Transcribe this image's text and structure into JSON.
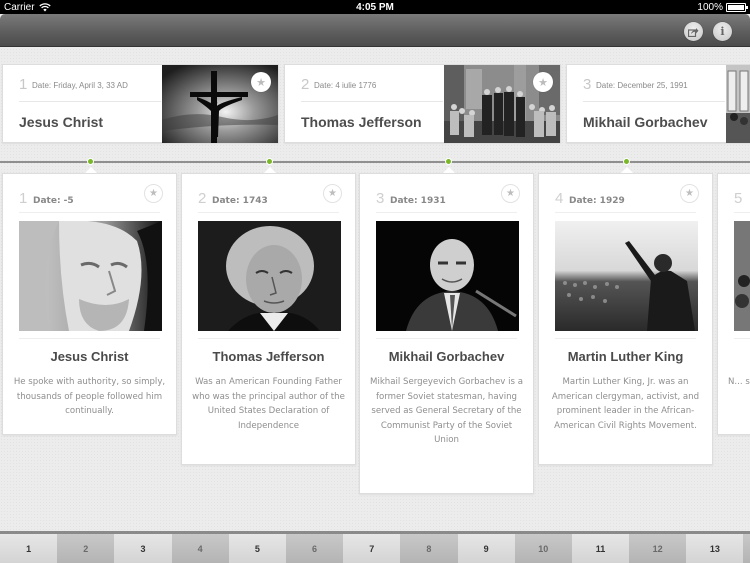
{
  "status_bar": {
    "carrier": "Carrier",
    "time": "4:05 PM",
    "battery": "100%",
    "battery_level": 1.0
  },
  "navbar": {
    "buttons": [
      {
        "name": "share",
        "icon": "share-icon"
      },
      {
        "name": "info",
        "icon": "info-icon",
        "glyph": "i"
      }
    ]
  },
  "star_glyph": "★",
  "top_cards": [
    {
      "index": "1",
      "date": "Date: Friday, April 3, 33 AD",
      "name": "Jesus Christ",
      "image": "crucifix-silhouette"
    },
    {
      "index": "2",
      "date": "Date: 4 iulie 1776",
      "name": "Thomas Jefferson",
      "image": "declaration-signing-painting"
    },
    {
      "index": "3",
      "date": "Date: December 25, 1991",
      "name": "Mikhail Gorbachev",
      "image": "gorbachev-event-photo"
    }
  ],
  "cards": [
    {
      "index": "1",
      "date": "Date: -5",
      "name": "Jesus Christ",
      "image": "jesus-statue-portrait",
      "description": "He spoke with authority, so simply, thousands of people followed him continually."
    },
    {
      "index": "2",
      "date": "Date: 1743",
      "name": "Thomas Jefferson",
      "image": "jefferson-portrait",
      "description": "Was an American Founding Father who was the principal author of the United States Declaration of Independence"
    },
    {
      "index": "3",
      "date": "Date: 1931",
      "name": "Mikhail Gorbachev",
      "image": "gorbachev-portrait",
      "description": "Mikhail Sergeyevich Gorbachev is a former Soviet statesman, having served as General Secretary of the Communist Party of the Soviet Union"
    },
    {
      "index": "4",
      "date": "Date: 1929",
      "name": "Martin Luther King",
      "image": "mlk-speech-crowd",
      "description": "Martin Luther King, Jr. was an American clergyman, activist, and prominent leader in the African-American Civil Rights Movement."
    },
    {
      "index": "5",
      "date": "",
      "name": "",
      "image": "crowd-photo",
      "description": "N... se... A..."
    }
  ],
  "pager": {
    "pages": [
      "1",
      "2",
      "3",
      "4",
      "5",
      "6",
      "7",
      "8",
      "9",
      "10",
      "11",
      "12",
      "13"
    ]
  },
  "colors": {
    "timeline_dot": "#7ab829",
    "navbar": "#5c5c5c",
    "text_dark": "#4a4a4a",
    "text_muted": "#8e8e8e"
  }
}
